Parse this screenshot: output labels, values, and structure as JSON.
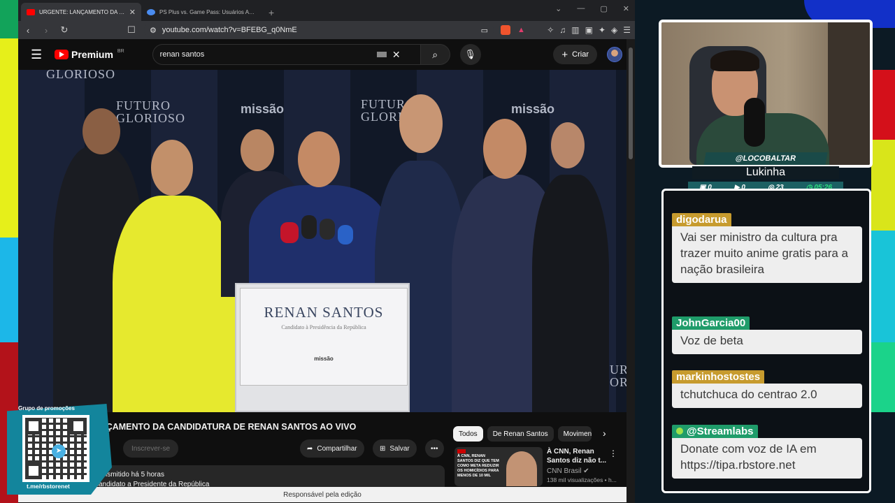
{
  "browser": {
    "tabs": [
      {
        "title": "URGENTE: LANÇAMENTO DA CANDIDATURA",
        "active": true,
        "favicon_color": "#ff0000"
      },
      {
        "title": "PS Plus vs. Game Pass: Usuários Ativos - Goo",
        "active": false,
        "favicon_color": "#4a8cf0"
      }
    ],
    "url": "youtube.com/watch?v=BFEBG_q0NmE"
  },
  "youtube": {
    "logo_text": "Premium",
    "logo_region": "BR",
    "search_query": "renan santos",
    "create_label": "Criar",
    "video_title": "LANÇAMENTO DA CANDIDATURA DE RENAN SANTOS AO VIVO",
    "subscribe_label": "Inscrever-se",
    "share_label": "Compartilhar",
    "save_label": "Salvar",
    "description_line1": "transmitido há 5 horas",
    "description_line2": "candidato a Presidente da República",
    "chips": [
      "Todos",
      "De Renan Santos",
      "Movimen"
    ],
    "recommendation": {
      "title_line1": "À CNN, Renan",
      "title_line2": "Santos diz não t...",
      "channel": "CNN Brasil",
      "views": "138 mil visualizações • h...",
      "thumb_text": "À CNN, RENAN SANTOS DIZ QUE TEM COMO META REDUZIR OS HOMICÍDIOS PARA MENOS DE 10 MIL"
    },
    "status_bar": "Responsável pela edição"
  },
  "video_scene": {
    "podium_name": "RENAN SANTOS",
    "podium_sub": "Candidato à Presidência da República",
    "podium_brand": "missão",
    "wall_texts": [
      "GLORIOSO",
      "FUTURO GLORIOSO",
      "missão",
      "FUTURO GLORIOSO",
      "missão",
      "UTUR GLORIO"
    ]
  },
  "promo": {
    "label": "Grupo de promoções",
    "link": "t.me/rbstorenet"
  },
  "streamer": {
    "handle": "@LOCOBALTAR",
    "nick": "Lukinha",
    "stats": [
      "0",
      "0",
      "23",
      "05:26"
    ]
  },
  "chat": [
    {
      "user": "digodarua",
      "text": "Vai ser ministro da cultura pra trazer muito anime gratis para a nação brasileira"
    },
    {
      "user": "JohnGarcia00",
      "text": "Voz de beta"
    },
    {
      "user": "markinhostostes",
      "text": "tchutchuca do centrao 2.0"
    },
    {
      "user": "@Streamlabs",
      "text": "Donate com voz de IA em https://tipa.rbstore.net"
    }
  ],
  "colors": {
    "youtube_red": "#ff0000",
    "chat_user_gold": "#c79b2e",
    "chat_user_green": "#1f9c6a",
    "nametag_teal": "#1c6063"
  }
}
